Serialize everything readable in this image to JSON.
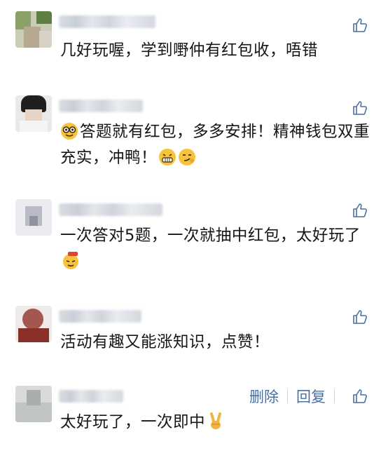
{
  "comments": [
    {
      "text": "几好玩喔，学到嘢仲有红包收，唔错"
    },
    {
      "text": "答题就有红包，多多安排！精神钱包双重充实，冲鸭！"
    },
    {
      "text": "一次答对5题，一次就抽中红包，太好玩了"
    },
    {
      "text": "活动有趣又能涨知识，点赞！"
    },
    {
      "text": "太好玩了，一次即中"
    }
  ],
  "own_comment_actions": {
    "delete_label": "删除",
    "reply_label": "回复"
  },
  "colors": {
    "accent": "#4a6fa5",
    "text": "#151515"
  }
}
